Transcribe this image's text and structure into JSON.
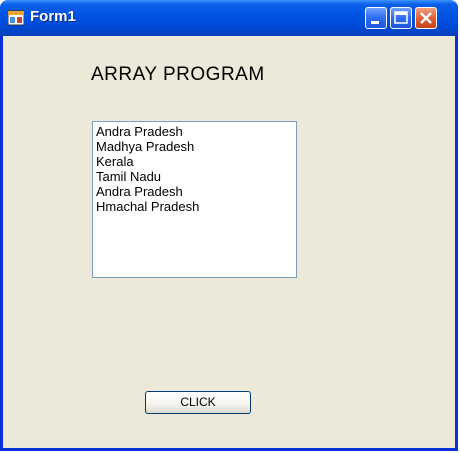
{
  "window": {
    "title": "Form1",
    "controls": {
      "minimize": "minimize-icon",
      "maximize": "maximize-icon",
      "close": "close-icon"
    }
  },
  "form": {
    "heading": "ARRAY PROGRAM",
    "listbox": {
      "items": [
        "Andra Pradesh",
        "Madhya Pradesh",
        "Kerala",
        "Tamil Nadu",
        "Andra Pradesh",
        "Hmachal Pradesh"
      ]
    },
    "button_label": "CLICK"
  },
  "colors": {
    "titlebar": "#0054e3",
    "form_background": "#ece9d8",
    "close_button": "#e0603a"
  }
}
